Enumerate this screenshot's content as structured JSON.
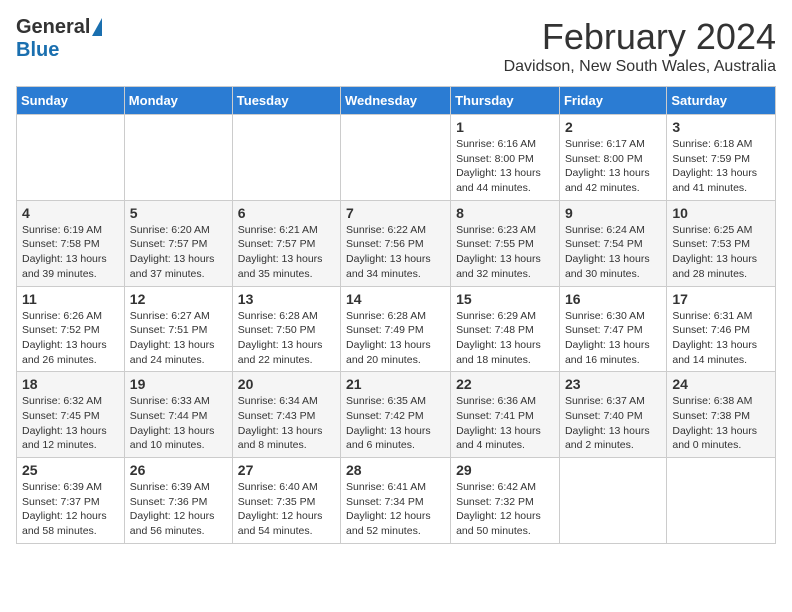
{
  "header": {
    "logo_general": "General",
    "logo_blue": "Blue",
    "title": "February 2024",
    "subtitle": "Davidson, New South Wales, Australia"
  },
  "weekdays": [
    "Sunday",
    "Monday",
    "Tuesday",
    "Wednesday",
    "Thursday",
    "Friday",
    "Saturday"
  ],
  "weeks": [
    [
      {
        "day": "",
        "info": ""
      },
      {
        "day": "",
        "info": ""
      },
      {
        "day": "",
        "info": ""
      },
      {
        "day": "",
        "info": ""
      },
      {
        "day": "1",
        "info": "Sunrise: 6:16 AM\nSunset: 8:00 PM\nDaylight: 13 hours and 44 minutes."
      },
      {
        "day": "2",
        "info": "Sunrise: 6:17 AM\nSunset: 8:00 PM\nDaylight: 13 hours and 42 minutes."
      },
      {
        "day": "3",
        "info": "Sunrise: 6:18 AM\nSunset: 7:59 PM\nDaylight: 13 hours and 41 minutes."
      }
    ],
    [
      {
        "day": "4",
        "info": "Sunrise: 6:19 AM\nSunset: 7:58 PM\nDaylight: 13 hours and 39 minutes."
      },
      {
        "day": "5",
        "info": "Sunrise: 6:20 AM\nSunset: 7:57 PM\nDaylight: 13 hours and 37 minutes."
      },
      {
        "day": "6",
        "info": "Sunrise: 6:21 AM\nSunset: 7:57 PM\nDaylight: 13 hours and 35 minutes."
      },
      {
        "day": "7",
        "info": "Sunrise: 6:22 AM\nSunset: 7:56 PM\nDaylight: 13 hours and 34 minutes."
      },
      {
        "day": "8",
        "info": "Sunrise: 6:23 AM\nSunset: 7:55 PM\nDaylight: 13 hours and 32 minutes."
      },
      {
        "day": "9",
        "info": "Sunrise: 6:24 AM\nSunset: 7:54 PM\nDaylight: 13 hours and 30 minutes."
      },
      {
        "day": "10",
        "info": "Sunrise: 6:25 AM\nSunset: 7:53 PM\nDaylight: 13 hours and 28 minutes."
      }
    ],
    [
      {
        "day": "11",
        "info": "Sunrise: 6:26 AM\nSunset: 7:52 PM\nDaylight: 13 hours and 26 minutes."
      },
      {
        "day": "12",
        "info": "Sunrise: 6:27 AM\nSunset: 7:51 PM\nDaylight: 13 hours and 24 minutes."
      },
      {
        "day": "13",
        "info": "Sunrise: 6:28 AM\nSunset: 7:50 PM\nDaylight: 13 hours and 22 minutes."
      },
      {
        "day": "14",
        "info": "Sunrise: 6:28 AM\nSunset: 7:49 PM\nDaylight: 13 hours and 20 minutes."
      },
      {
        "day": "15",
        "info": "Sunrise: 6:29 AM\nSunset: 7:48 PM\nDaylight: 13 hours and 18 minutes."
      },
      {
        "day": "16",
        "info": "Sunrise: 6:30 AM\nSunset: 7:47 PM\nDaylight: 13 hours and 16 minutes."
      },
      {
        "day": "17",
        "info": "Sunrise: 6:31 AM\nSunset: 7:46 PM\nDaylight: 13 hours and 14 minutes."
      }
    ],
    [
      {
        "day": "18",
        "info": "Sunrise: 6:32 AM\nSunset: 7:45 PM\nDaylight: 13 hours and 12 minutes."
      },
      {
        "day": "19",
        "info": "Sunrise: 6:33 AM\nSunset: 7:44 PM\nDaylight: 13 hours and 10 minutes."
      },
      {
        "day": "20",
        "info": "Sunrise: 6:34 AM\nSunset: 7:43 PM\nDaylight: 13 hours and 8 minutes."
      },
      {
        "day": "21",
        "info": "Sunrise: 6:35 AM\nSunset: 7:42 PM\nDaylight: 13 hours and 6 minutes."
      },
      {
        "day": "22",
        "info": "Sunrise: 6:36 AM\nSunset: 7:41 PM\nDaylight: 13 hours and 4 minutes."
      },
      {
        "day": "23",
        "info": "Sunrise: 6:37 AM\nSunset: 7:40 PM\nDaylight: 13 hours and 2 minutes."
      },
      {
        "day": "24",
        "info": "Sunrise: 6:38 AM\nSunset: 7:38 PM\nDaylight: 13 hours and 0 minutes."
      }
    ],
    [
      {
        "day": "25",
        "info": "Sunrise: 6:39 AM\nSunset: 7:37 PM\nDaylight: 12 hours and 58 minutes."
      },
      {
        "day": "26",
        "info": "Sunrise: 6:39 AM\nSunset: 7:36 PM\nDaylight: 12 hours and 56 minutes."
      },
      {
        "day": "27",
        "info": "Sunrise: 6:40 AM\nSunset: 7:35 PM\nDaylight: 12 hours and 54 minutes."
      },
      {
        "day": "28",
        "info": "Sunrise: 6:41 AM\nSunset: 7:34 PM\nDaylight: 12 hours and 52 minutes."
      },
      {
        "day": "29",
        "info": "Sunrise: 6:42 AM\nSunset: 7:32 PM\nDaylight: 12 hours and 50 minutes."
      },
      {
        "day": "",
        "info": ""
      },
      {
        "day": "",
        "info": ""
      }
    ]
  ]
}
